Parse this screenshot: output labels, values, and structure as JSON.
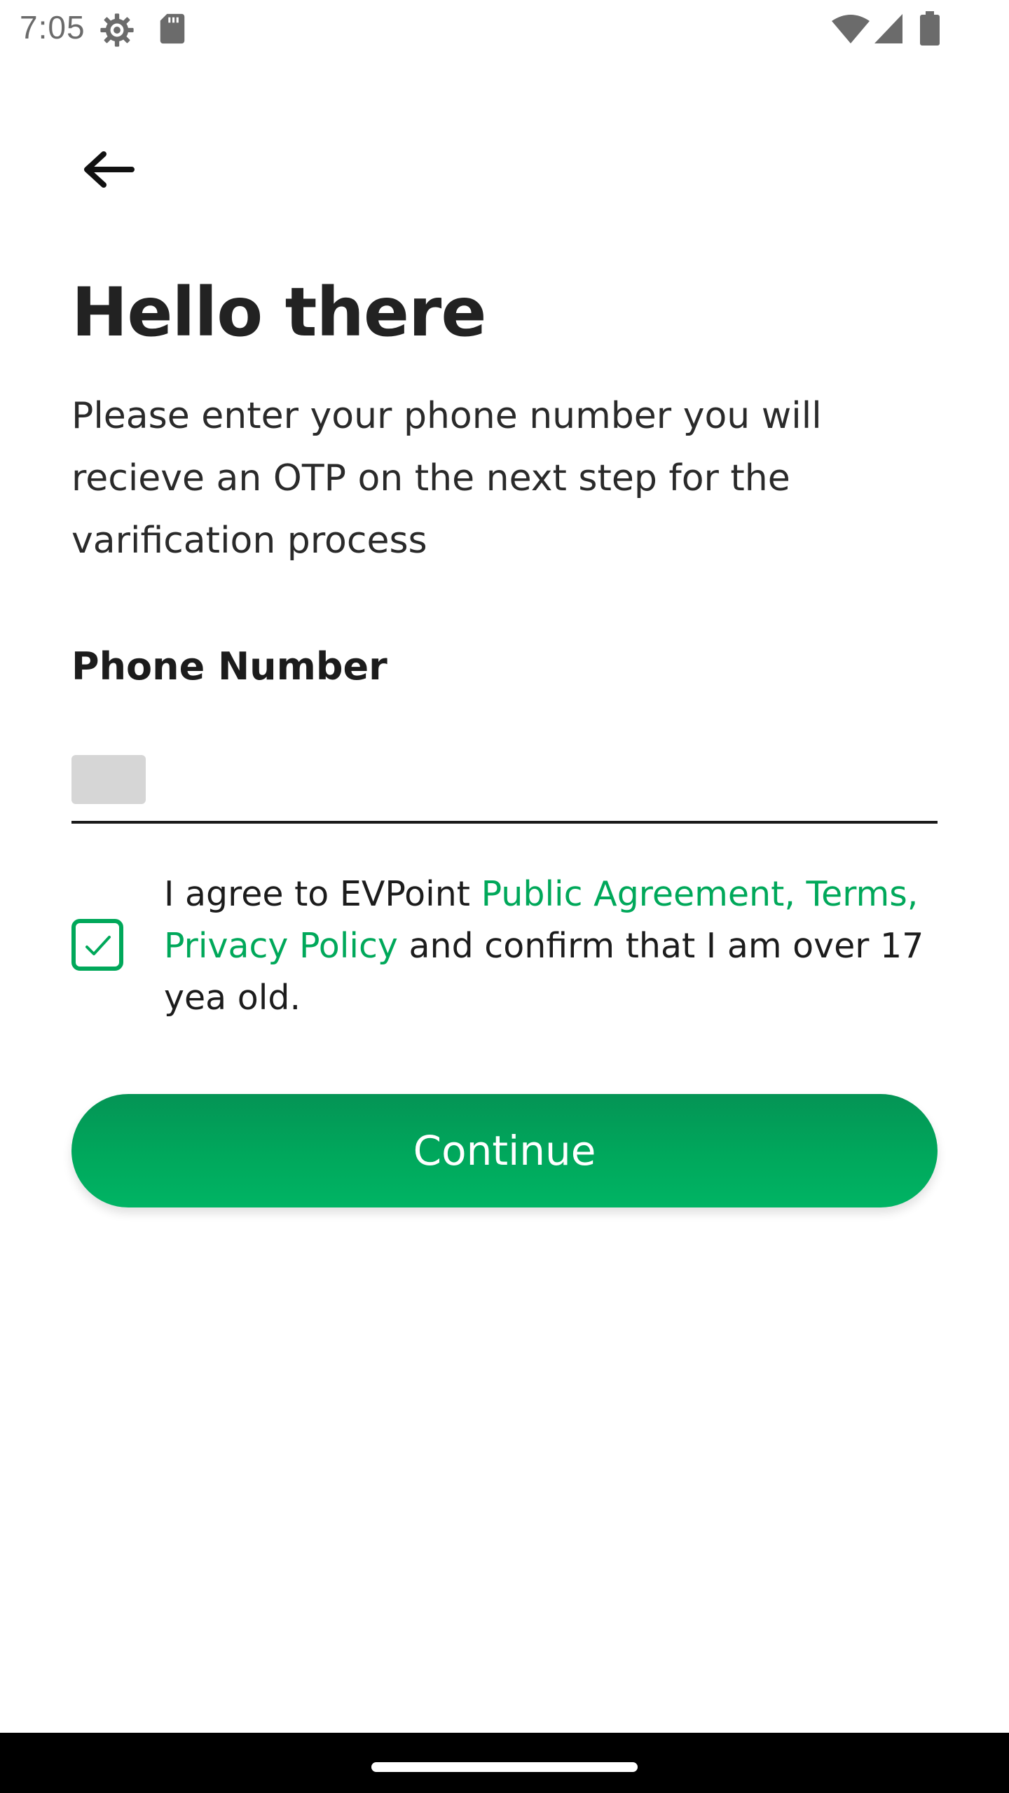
{
  "status_bar": {
    "time": "7:05",
    "icons": [
      "gear-icon",
      "sd-card-icon",
      "wifi-icon",
      "signal-icon",
      "battery-icon"
    ]
  },
  "header": {
    "back_icon": "arrow-left-icon"
  },
  "content": {
    "title": "Hello there",
    "subtitle": "Please enter your phone number you will recieve an OTP on the next step for the varification process",
    "phone_label": "Phone Number",
    "phone_value": "",
    "agreement": {
      "checked": true,
      "prefix": "I agree to EVPoint ",
      "link_text": "Public Agreement, Terms, Privacy Policy",
      "suffix": " and confirm that I am over 17 yea old."
    },
    "continue_label": "Continue"
  },
  "colors": {
    "accent": "#00a85a",
    "button_top": "#049455",
    "button_bottom": "#00b464",
    "text_dark": "#222222",
    "status_gray": "#6b6b6b",
    "prefix_gray": "#d6d6d6"
  }
}
